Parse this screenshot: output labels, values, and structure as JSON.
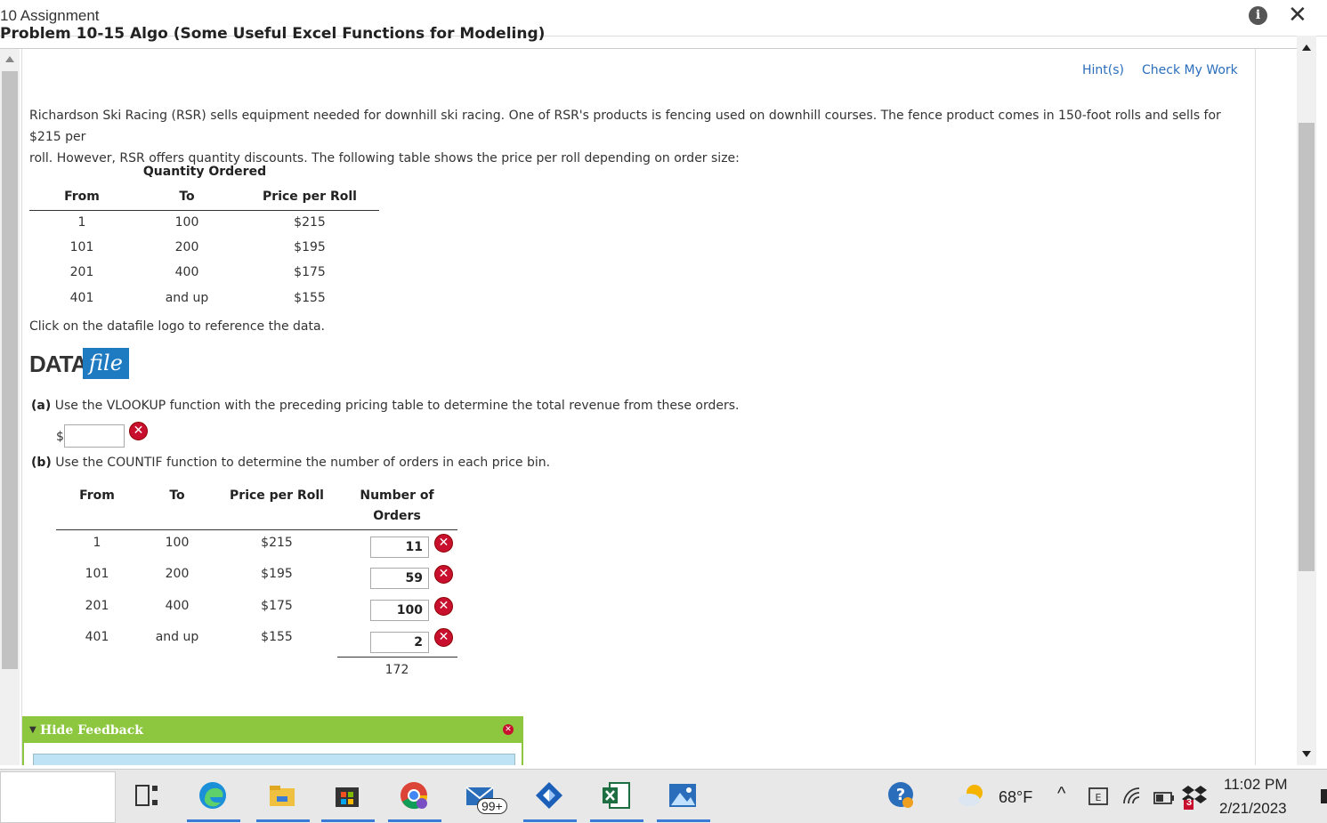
{
  "window": {
    "title": "10 Assignment",
    "subheading": "Problem 10-15 Algo (Some Useful Excel Functions for Modeling)"
  },
  "toolbar": {
    "hints": "Hint(s)",
    "check_work": "Check My Work"
  },
  "problem": {
    "intro_line1": "Richardson Ski Racing (RSR) sells equipment needed for downhill ski racing. One of RSR's products is fencing used on downhill courses. The fence product comes in 150-foot rolls and sells for $215 per",
    "intro_line2": "roll. However, RSR offers quantity discounts. The following table shows the price per roll depending on order size:",
    "click_note": "Click on the datafile logo to reference the data.",
    "datafile_logo": {
      "data": "DATA",
      "file": "file"
    }
  },
  "pricing_table": {
    "group_header": "Quantity Ordered",
    "headers": [
      "From",
      "To",
      "Price per Roll"
    ],
    "rows": [
      [
        "1",
        "100",
        "$215"
      ],
      [
        "101",
        "200",
        "$195"
      ],
      [
        "201",
        "400",
        "$175"
      ],
      [
        "401",
        "and up",
        "$155"
      ]
    ]
  },
  "part_a": {
    "label": "(a)",
    "text": "Use the VLOOKUP function with the preceding pricing table to determine the total revenue from these orders.",
    "currency": "$",
    "value": ""
  },
  "part_b": {
    "label": "(b)",
    "text": "Use the COUNTIF function to determine the number of orders in each price bin.",
    "headers": [
      "From",
      "To",
      "Price per Roll",
      "Number of",
      "Orders"
    ],
    "rows": [
      {
        "from": "1",
        "to": "100",
        "price": "$215",
        "orders": "11"
      },
      {
        "from": "101",
        "to": "200",
        "price": "$195",
        "orders": "59"
      },
      {
        "from": "201",
        "to": "400",
        "price": "$175",
        "orders": "100"
      },
      {
        "from": "401",
        "to": "and up",
        "price": "$155",
        "orders": "2"
      }
    ],
    "total": "172"
  },
  "feedback": {
    "label": "Hide Feedback"
  },
  "taskbar": {
    "mail_badge": "99+",
    "weather": "68°F",
    "time": "11:02 PM",
    "date": "2/21/2023",
    "notify_badge": "3"
  },
  "colors": {
    "link": "#2a6ebb",
    "feedback_green": "#8dc63f",
    "error_red": "#c8102e",
    "datafile_blue": "#1f7bc1"
  }
}
